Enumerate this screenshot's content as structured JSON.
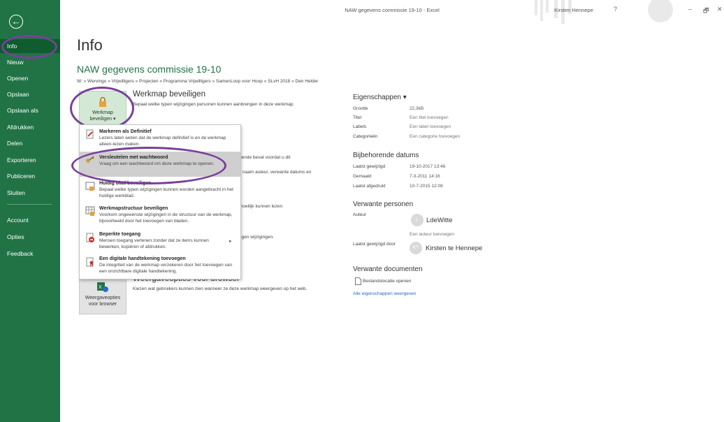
{
  "window": {
    "title": "NAW gegevens commissie 19-10  -  Excel",
    "user": "Kirsten Hennepe",
    "help": "?",
    "minimize": "–",
    "restore": "🗗",
    "close": "✕"
  },
  "sidebar": {
    "back": "←",
    "items": [
      {
        "label": "Info",
        "active": true
      },
      {
        "label": "Nieuw"
      },
      {
        "label": "Openen"
      },
      {
        "label": "Opslaan"
      },
      {
        "label": "Opslaan als"
      },
      {
        "label": "Afdrukken"
      },
      {
        "label": "Delen"
      },
      {
        "label": "Exporteren"
      },
      {
        "label": "Publiceren"
      },
      {
        "label": "Sluiten"
      },
      {
        "label": "Account"
      },
      {
        "label": "Opties"
      },
      {
        "label": "Feedback"
      }
    ]
  },
  "main": {
    "page_title": "Info",
    "doc_title": "NAW gegevens commissie 19-10",
    "breadcrumb": "W: » Wervingo » Vrijwilligers » Projecten » Programma Vrijwilligers » SamenLoop voor Hoop » SLvH 2018 » Den Helder",
    "protect": {
      "button_line1": "Werkmap",
      "button_line2": "beveiligen ▾",
      "title": "Werkmap beveiligen",
      "desc": "Bepaal welke typen wijzigingen personen kunnen aanbrengen in deze werkmap."
    },
    "hidden_fragments": [
      "gende bevat voordat u dit",
      "l, naam auteur, verwante datums en",
      "moeilijk kunnen lezen",
      "agen wijzigingen."
    ],
    "browser": {
      "button_line1": "Weergaveopties",
      "button_line2": "voor browser",
      "title": "Weergaveopties voor browser",
      "desc": "Kiezen wat gebruikers kunnen zien wanneer ze deze werkmap weergeven op het web."
    }
  },
  "dropdown": {
    "items": [
      {
        "title": "Markeren als Definitief",
        "desc": "Lezers laten weten dat de werkmap definitief is en de werkmap alleen-lezen maken."
      },
      {
        "title": "Versleutelen met wachtwoord",
        "desc": "Vraag om een wachtwoord om deze werkmap te openen."
      },
      {
        "title": "Huidig blad beveiligen",
        "desc": "Bepaal welke typen wijzigingen kunnen worden aangebracht in het huidige werkblad."
      },
      {
        "title": "Werkmapstructuur beveiligen",
        "desc": "Voorkom ongewenste wijzigingen in de structuur van de werkmap, bijvoorbeeld door het toevoegen van bladen."
      },
      {
        "title": "Beperkte toegang",
        "desc": "Mensen toegang verlenen zonder dat ze items kunnen bewerken, kopiëren of afdrukken.",
        "arrow": "▸"
      },
      {
        "title": "Een digitale handtekening toevoegen",
        "desc": "De integriteit van de werkmap verzekeren door het toevoegen van een onzichtbare digitale handtekening."
      }
    ]
  },
  "properties": {
    "header": "Eigenschappen ▾",
    "size_label": "Grootte",
    "size_value": "22,3kB",
    "title_label": "Titel",
    "title_value": "Een titel toevoegen",
    "labels_label": "Labels",
    "labels_value": "Een label toevoegen",
    "categories_label": "Categorieën",
    "categories_value": "Een categorie toevoegen"
  },
  "dates": {
    "header": "Bijbehorende datums",
    "modified_label": "Laatst gewijzigd",
    "modified_value": "19-10-2017 13:46",
    "created_label": "Gemaakt",
    "created_value": "7-3-2011 14:16",
    "printed_label": "Laatst afgedrukt",
    "printed_value": "10-7-2015 12:08"
  },
  "people": {
    "header": "Verwante personen",
    "author_label": "Auteur",
    "author_initial": "L",
    "author_name": "LdeWitte",
    "add_author": "Een auteur toevoegen",
    "modified_by_label": "Laatst gewijzigd door",
    "modified_by_initials": "KT",
    "modified_by_name": "Kirsten te Hennepe"
  },
  "documents": {
    "header": "Verwante documenten",
    "open_location": "Bestandslocatie openen",
    "all_properties": "Alle eigenschappen weergeven"
  },
  "colors": {
    "accent": "#217346",
    "annotation_ring": "#7b3f99",
    "dropdown_highlight": "#cfcfcf"
  }
}
